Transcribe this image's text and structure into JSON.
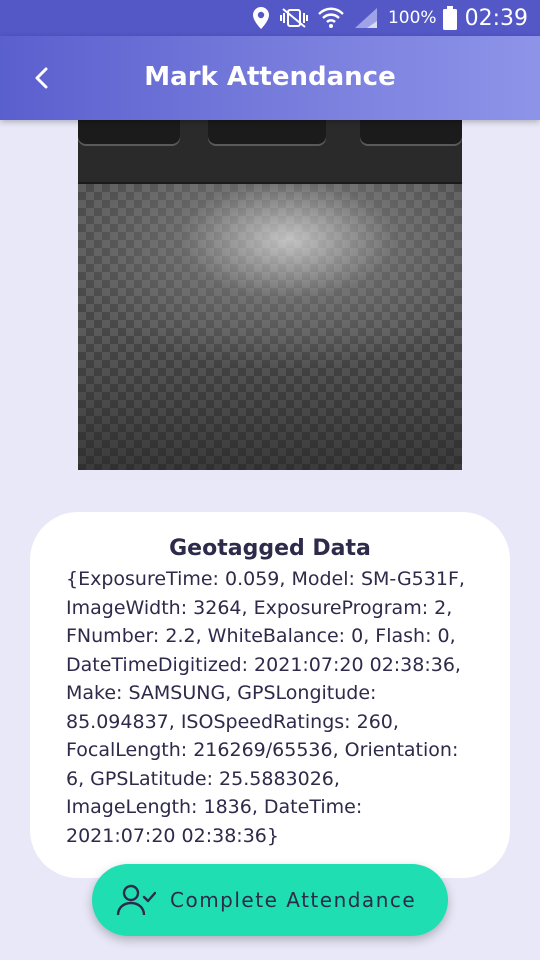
{
  "status_bar": {
    "battery_pct": "100%",
    "time": "02:39",
    "icons": [
      "location-icon",
      "vibrate-icon",
      "wifi-icon",
      "signal-icon",
      "battery-icon"
    ]
  },
  "app_bar": {
    "title": "Mark Attendance",
    "back_icon": "chevron-left-icon"
  },
  "card": {
    "title": "Geotagged Data",
    "body": "{ExposureTime: 0.059, Model: SM-G531F, ImageWidth: 3264, ExposureProgram: 2, FNumber: 2.2, WhiteBalance: 0, Flash: 0, DateTimeDigitized: 2021:07:20 02:38:36, Make: SAMSUNG, GPSLongitude: 85.094837, ISOSpeedRatings: 260, FocalLength: 216269/65536, Orientation: 6, GPSLatitude: 25.5883026, ImageLength: 1836, DateTime: 2021:07:20 02:38:36}"
  },
  "action": {
    "label": "Complete Attendance",
    "icon": "user-check-icon"
  },
  "colors": {
    "app_bar_start": "#5a5fce",
    "app_bar_end": "#8d94e8",
    "background": "#e8e8f8",
    "button": "#1fdfb2",
    "text": "#2e2a4a"
  }
}
